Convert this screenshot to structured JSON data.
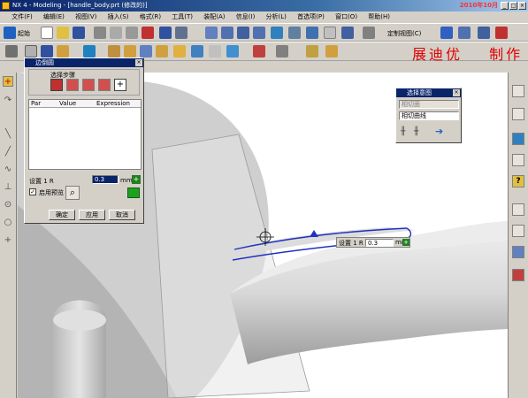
{
  "window": {
    "title": "NX 4 - Modeling - [handle_body.prt (修改的)]",
    "date_overlay": "2010年10月"
  },
  "menu": [
    "文件(F)",
    "编辑(E)",
    "视图(V)",
    "插入(S)",
    "格式(R)",
    "工具(T)",
    "装配(A)",
    "信息(I)",
    "分析(L)",
    "首选项(P)",
    "窗口(O)",
    "帮助(H)"
  ],
  "toolbar": {
    "start_label": "起始",
    "custom_view_label": "定制视图(C)"
  },
  "brand": {
    "author_label": "展迪优",
    "made_label": "制作"
  },
  "dialog_offset": {
    "title": "边倒圆",
    "steps_label": "选择步骤",
    "columns": [
      "Par",
      "Value",
      "Expression"
    ],
    "rows": [],
    "setting_label": "设置 1 R",
    "value": "0.3",
    "unit": "mm",
    "preview_label": "启用预览",
    "ok_label": "确定",
    "apply_label": "应用",
    "cancel_label": "取消"
  },
  "selection_dialog": {
    "title": "选择意图",
    "option1": "相切面",
    "option2": "相切曲线"
  },
  "canvas_input": {
    "label": "设置 1 R",
    "value": "0.3",
    "unit": "mm"
  },
  "colors": {
    "title_bar": "#0a246a",
    "model_surface": "#c8c8c8",
    "selected_edge": "#2030c0",
    "brand_text": "#e00000"
  }
}
